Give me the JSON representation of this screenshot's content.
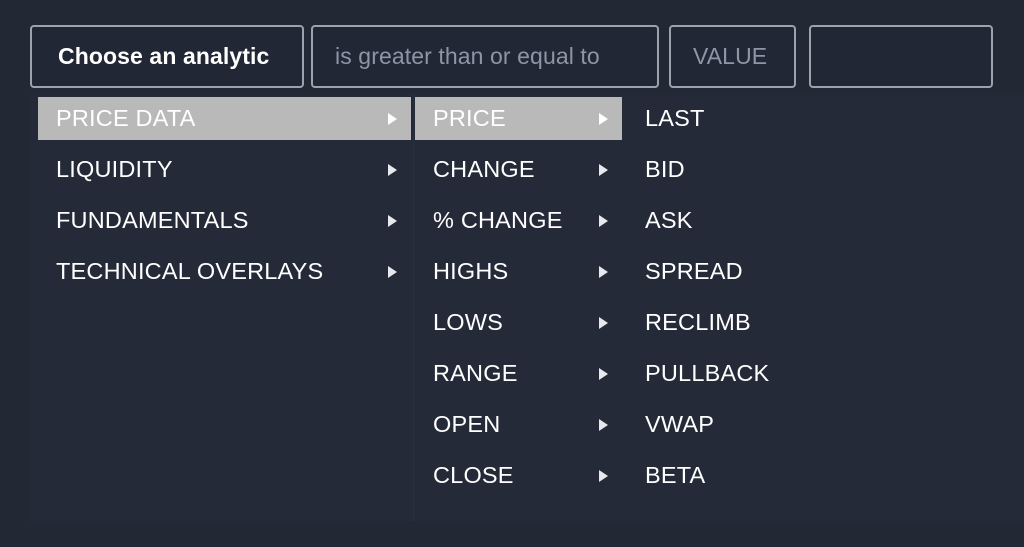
{
  "query_bar": {
    "analytic": {
      "value": "Choose an analytic",
      "placeholder": "Choose an analytic"
    },
    "operator": {
      "value": "is greater than or equal to",
      "placeholder": "is greater than or equal to"
    },
    "value": {
      "value": "",
      "placeholder": "VALUE"
    },
    "extra": {
      "value": "",
      "placeholder": ""
    }
  },
  "menu": {
    "category_column": [
      {
        "label": "PRICE DATA",
        "has_submenu": true,
        "selected": true
      },
      {
        "label": "LIQUIDITY",
        "has_submenu": true,
        "selected": false
      },
      {
        "label": "FUNDAMENTALS",
        "has_submenu": true,
        "selected": false
      },
      {
        "label": "TECHNICAL OVERLAYS",
        "has_submenu": true,
        "selected": false
      }
    ],
    "metric_column": [
      {
        "label": "PRICE",
        "has_submenu": true,
        "selected": true
      },
      {
        "label": "CHANGE",
        "has_submenu": true,
        "selected": false
      },
      {
        "label": "% CHANGE",
        "has_submenu": true,
        "selected": false
      },
      {
        "label": "HIGHS",
        "has_submenu": true,
        "selected": false
      },
      {
        "label": "LOWS",
        "has_submenu": true,
        "selected": false
      },
      {
        "label": "RANGE",
        "has_submenu": true,
        "selected": false
      },
      {
        "label": "OPEN",
        "has_submenu": true,
        "selected": false
      },
      {
        "label": "CLOSE",
        "has_submenu": true,
        "selected": false
      }
    ],
    "field_column": [
      {
        "label": "LAST",
        "has_submenu": false,
        "selected": false
      },
      {
        "label": "BID",
        "has_submenu": false,
        "selected": false
      },
      {
        "label": "ASK",
        "has_submenu": false,
        "selected": false
      },
      {
        "label": "SPREAD",
        "has_submenu": false,
        "selected": false
      },
      {
        "label": "RECLIMB",
        "has_submenu": false,
        "selected": false
      },
      {
        "label": "PULLBACK",
        "has_submenu": false,
        "selected": false
      },
      {
        "label": "VWAP",
        "has_submenu": false,
        "selected": false
      },
      {
        "label": "BETA",
        "has_submenu": false,
        "selected": false
      }
    ]
  },
  "colors": {
    "background": "#222834",
    "panel": "#242a37",
    "field_border": "#9aa3b0",
    "field_fill": "#212735",
    "text_primary": "#ffffff",
    "text_placeholder": "#8d96a5",
    "highlight": "#b9b9b9"
  }
}
